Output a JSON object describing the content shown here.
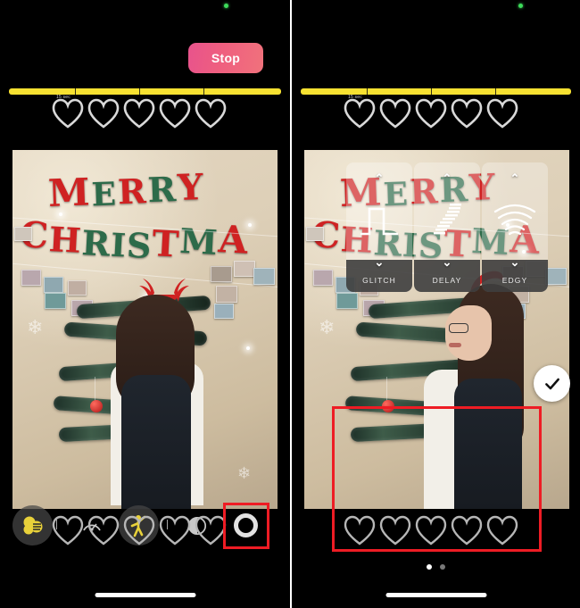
{
  "app": {
    "screens": [
      {
        "id": "recording-screen",
        "recording_indicator": "green-dot",
        "stop_label": "Stop",
        "duration_label": "15 sec",
        "record_button": "record-ring",
        "has_effects_panel": false,
        "highlight": "record-button"
      },
      {
        "id": "effects-screen",
        "recording_indicator": "green-dot",
        "duration_label": "15 sec",
        "confirm_icon": "check-icon",
        "has_effects_panel": true,
        "highlight": "effects-panel"
      }
    ]
  },
  "timeline": {
    "segments": 4,
    "fill_color": "#f7e131",
    "duration_label": "15 sec"
  },
  "hearts": {
    "count": 5,
    "icon": "heart-outline-icon"
  },
  "effects": {
    "cards": [
      {
        "label": "GLITCH",
        "icon": "square-wave-icon",
        "up": "chevron-up-icon",
        "down": "chevron-down-icon"
      },
      {
        "label": "DELAY",
        "icon": "sound-bars-icon",
        "up": "chevron-up-icon",
        "down": "chevron-down-icon"
      },
      {
        "label": "EDGY",
        "icon": "wifi-arcs-icon",
        "up": "chevron-up-icon",
        "down": "chevron-down-icon"
      }
    ]
  },
  "pagination": {
    "dots": 2,
    "active_index": 0,
    "active_color": "#ffffff",
    "inactive_color": "#787878"
  },
  "toolbar": {
    "items": [
      {
        "name": "filters-button",
        "icon": "color-circles-icon",
        "active": true
      },
      {
        "name": "speed-button",
        "icon": "speedometer-icon",
        "active": false
      },
      {
        "name": "dance-effect-button",
        "icon": "dancing-person-icon",
        "active": true
      },
      {
        "name": "contrast-button",
        "icon": "half-circle-icon",
        "active": false
      }
    ],
    "record_button": "record-ring-button"
  },
  "scene": {
    "banner_top": "MERRY",
    "banner_bottom": "CHRISTMA",
    "description": "christmas-wall-decoration"
  },
  "colors": {
    "stop_gradient_from": "#e8538c",
    "stop_gradient_to": "#f0727c",
    "timeline_yellow": "#f7e131",
    "highlight_red": "#ee1c24",
    "accent_yellow": "#e8d13a",
    "rec_green": "#3ddc5a"
  }
}
